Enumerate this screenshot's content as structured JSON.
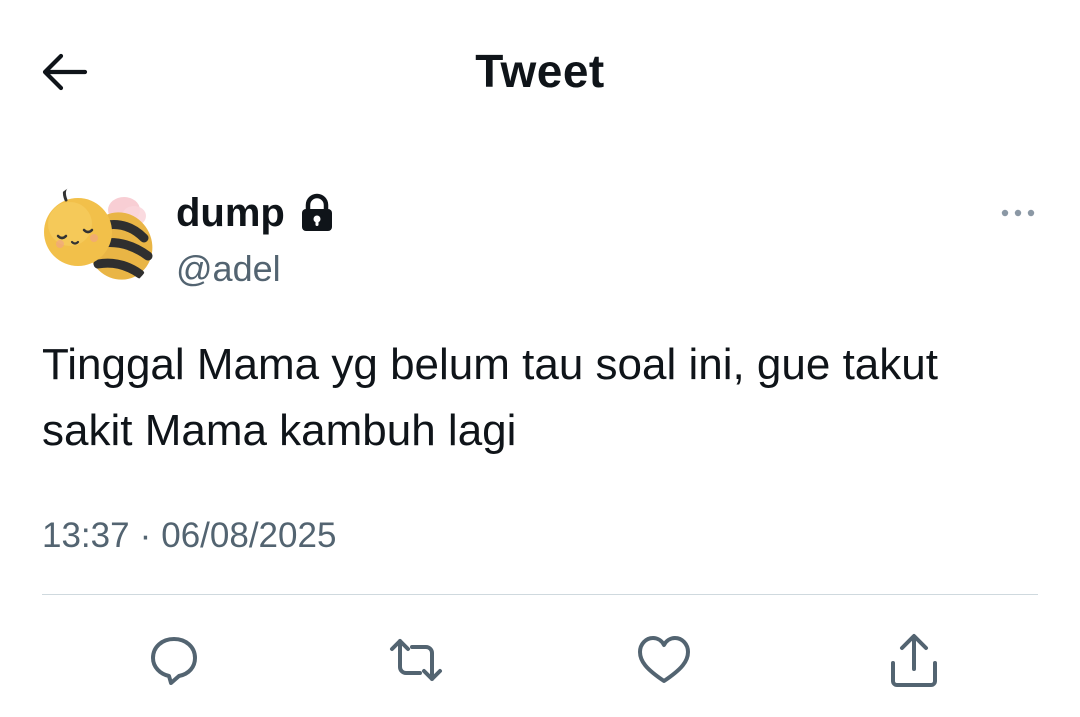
{
  "header": {
    "title": "Tweet",
    "back_icon": "arrow-left-icon"
  },
  "author": {
    "display_name": "dump",
    "handle": "@adel",
    "protected_icon": "lock-icon",
    "avatar": "bee-avatar",
    "more_icon": "more-horizontal-icon"
  },
  "tweet": {
    "text": "Tinggal Mama yg belum tau soal ini, gue takut sakit Mama kambuh lagi",
    "time": "13:37",
    "separator": "·",
    "date": "06/08/2025"
  },
  "actions": [
    {
      "name": "reply",
      "icon": "reply-icon"
    },
    {
      "name": "retweet",
      "icon": "retweet-icon"
    },
    {
      "name": "like",
      "icon": "heart-icon"
    },
    {
      "name": "share",
      "icon": "share-icon"
    }
  ],
  "colors": {
    "text_primary": "#0f1419",
    "text_secondary": "#536471",
    "divider": "#cfd9de",
    "icon": "#536471"
  }
}
